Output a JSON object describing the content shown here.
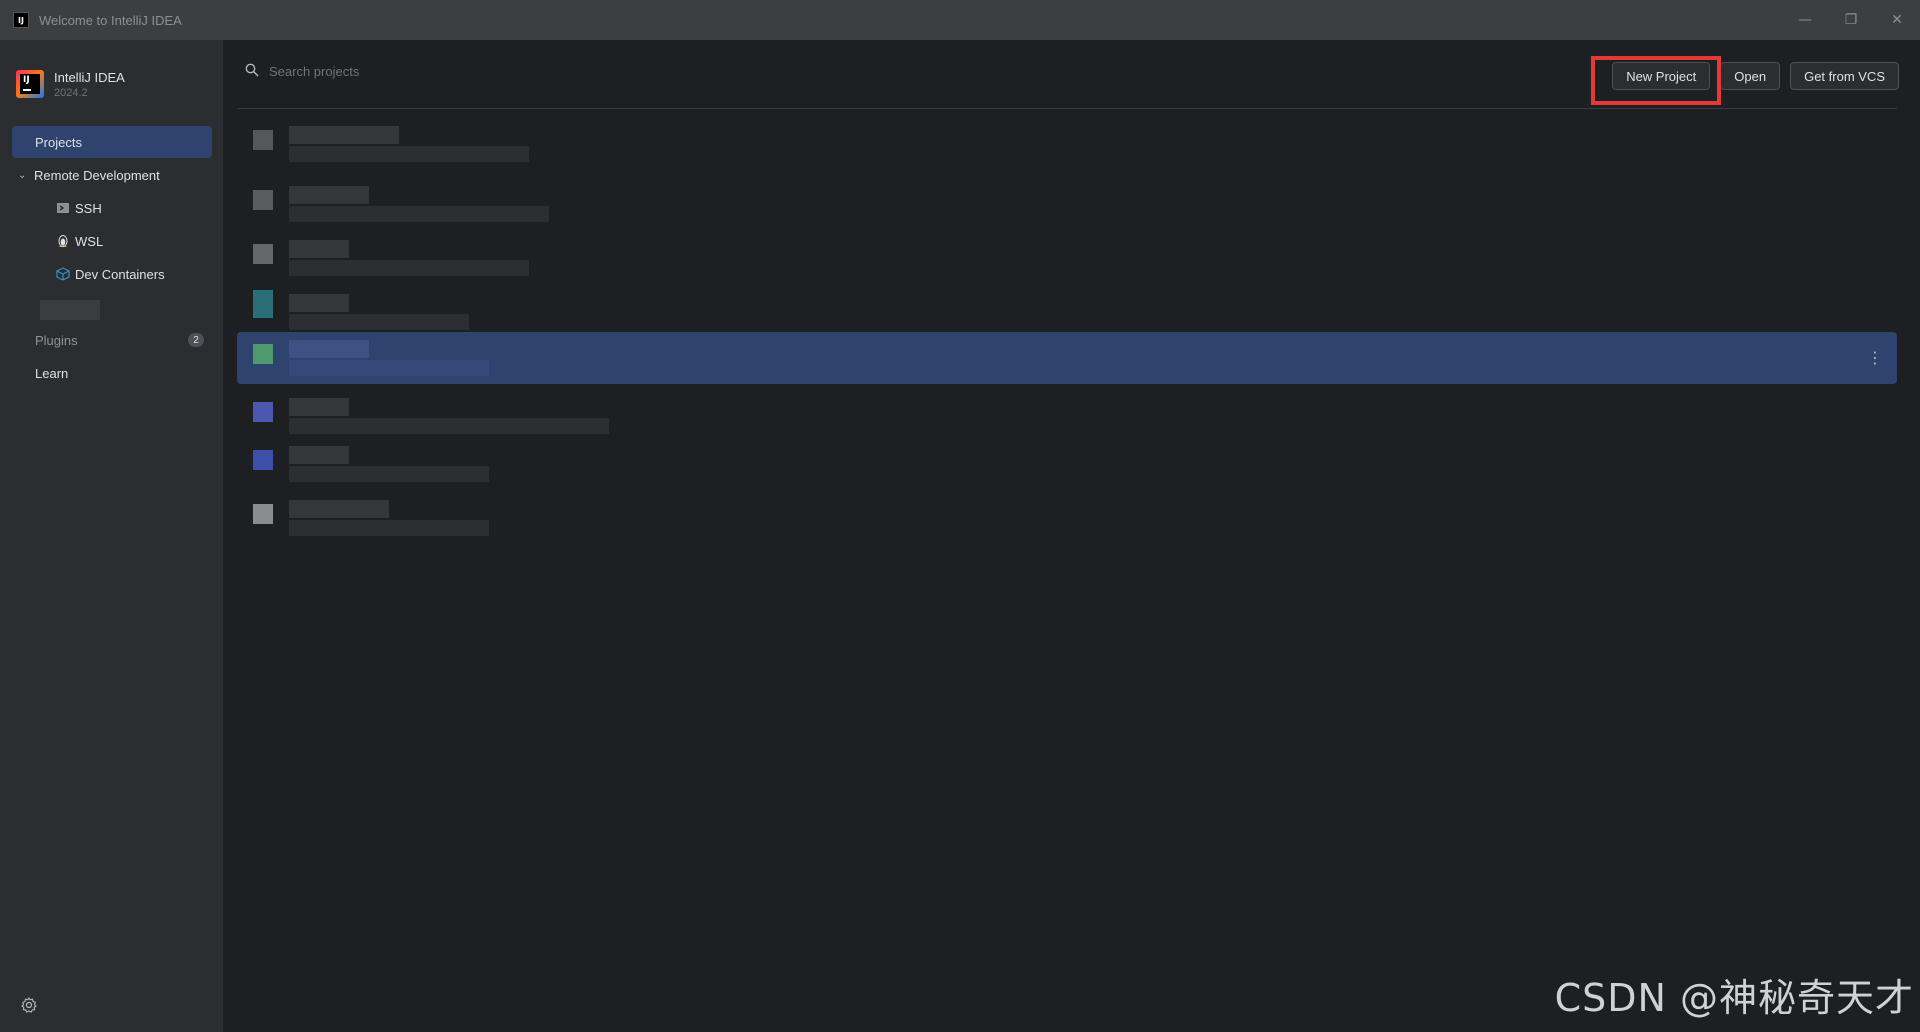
{
  "window": {
    "title": "Welcome to IntelliJ IDEA",
    "controls": [
      "minimize",
      "restore",
      "close"
    ]
  },
  "brand": {
    "name": "IntelliJ IDEA",
    "version": "2024.2"
  },
  "sidebar": {
    "items": [
      {
        "label": "Projects",
        "active": true
      },
      {
        "label": "Remote Development",
        "expanded": true
      },
      {
        "label": "SSH",
        "icon": "terminal-icon"
      },
      {
        "label": "WSL",
        "icon": "linux-penguin-icon"
      },
      {
        "label": "Dev Containers",
        "icon": "cube-icon"
      },
      {
        "label": "Plugins",
        "badge": "2"
      },
      {
        "label": "Learn"
      }
    ]
  },
  "search": {
    "placeholder": "Search projects"
  },
  "actions": {
    "new_project": "New Project",
    "open": "Open",
    "get_from_vcs": "Get from VCS"
  },
  "projects": {
    "icon_colors": [
      "#555759",
      "#5a5c5f",
      "#646669",
      "#2a6e7a",
      "#4e9a6e",
      "#4a58b0",
      "#3e4fa8",
      "#8a8c8e"
    ],
    "selected_index": 4
  },
  "watermark": "CSDN @神秘奇天才"
}
